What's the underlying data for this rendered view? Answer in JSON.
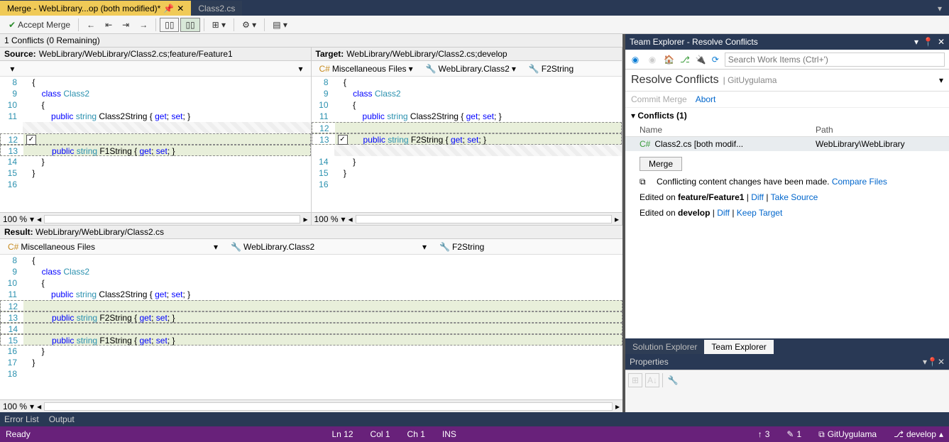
{
  "tabs": {
    "active": "Merge - WebLibrary...op (both modified)*",
    "other": "Class2.cs"
  },
  "toolbar": {
    "accept": "Accept Merge"
  },
  "conflicts_summary": "1 Conflicts (0 Remaining)",
  "source": {
    "label": "Source:",
    "path": "WebLibrary/WebLibrary/Class2.cs;feature/Feature1",
    "zoom": "100 %"
  },
  "target": {
    "label": "Target:",
    "path": "WebLibrary/WebLibrary/Class2.cs;develop",
    "crumb1": "Miscellaneous Files",
    "crumb2": "WebLibrary.Class2",
    "crumb3": "F2String",
    "zoom": "100 %"
  },
  "result": {
    "label": "Result:",
    "path": "WebLibrary/WebLibrary/Class2.cs",
    "crumb1": "Miscellaneous Files",
    "crumb2": "WebLibrary.Class2",
    "crumb3": "F2String",
    "zoom": "100 %"
  },
  "code": {
    "source_lines": [
      {
        "n": 8,
        "t": "    {"
      },
      {
        "n": 9,
        "t": "        class Class2"
      },
      {
        "n": 10,
        "t": "        {"
      },
      {
        "n": 11,
        "t": "            public string Class2String { get; set; }"
      },
      {
        "n": "",
        "t": "",
        "hatch": true
      },
      {
        "n": 12,
        "t": "",
        "diff": true,
        "cb": true
      },
      {
        "n": 13,
        "t": "            public string F1String { get; set; }",
        "diff": true
      },
      {
        "n": 14,
        "t": "        }"
      },
      {
        "n": 15,
        "t": "    }"
      },
      {
        "n": 16,
        "t": ""
      }
    ],
    "target_lines": [
      {
        "n": 8,
        "t": "    {"
      },
      {
        "n": 9,
        "t": "        class Class2"
      },
      {
        "n": 10,
        "t": "        {"
      },
      {
        "n": 11,
        "t": "            public string Class2String { get; set; }"
      },
      {
        "n": 12,
        "t": "",
        "diff": true
      },
      {
        "n": 13,
        "t": "            public string F2String { get; set; }",
        "diff": true,
        "cb": true
      },
      {
        "n": "",
        "t": "",
        "hatch": true
      },
      {
        "n": 14,
        "t": "        }"
      },
      {
        "n": 15,
        "t": "    }"
      },
      {
        "n": 16,
        "t": ""
      }
    ],
    "result_lines": [
      {
        "n": 8,
        "t": "    {"
      },
      {
        "n": 9,
        "t": "        class Class2"
      },
      {
        "n": 10,
        "t": "        {"
      },
      {
        "n": 11,
        "t": "            public string Class2String { get; set; }"
      },
      {
        "n": 12,
        "t": "",
        "diff": true
      },
      {
        "n": 13,
        "t": "            public string F2String { get; set; }",
        "diff": true
      },
      {
        "n": 14,
        "t": "",
        "diff": true
      },
      {
        "n": 15,
        "t": "            public string F1String { get; set; }",
        "diff": true
      },
      {
        "n": 16,
        "t": "        }"
      },
      {
        "n": 17,
        "t": "    }"
      },
      {
        "n": 18,
        "t": ""
      }
    ]
  },
  "team_explorer": {
    "title": "Team Explorer - Resolve Conflicts",
    "search_placeholder": "Search Work Items (Ctrl+')",
    "heading": "Resolve Conflicts",
    "project": "GitUygulama",
    "commit_merge": "Commit Merge",
    "abort": "Abort",
    "conflicts_label": "Conflicts (1)",
    "col_name": "Name",
    "col_path": "Path",
    "row_name": "Class2.cs [both modif...",
    "row_path": "WebLibrary\\WebLibrary",
    "merge_btn": "Merge",
    "info_text": "Conflicting content changes have been made.",
    "compare_files": "Compare Files",
    "edited1_a": "Edited on ",
    "edited1_b": "feature/Feature1",
    "diff": "Diff",
    "take_source": "Take Source",
    "edited2_a": "Edited on ",
    "edited2_b": "develop",
    "keep_target": "Keep Target"
  },
  "right_tabs": {
    "solution": "Solution Explorer",
    "team": "Team Explorer"
  },
  "properties": {
    "title": "Properties"
  },
  "bottom": {
    "errors": "Error List",
    "output": "Output"
  },
  "status": {
    "ready": "Ready",
    "ln": "Ln 12",
    "col": "Col 1",
    "ch": "Ch 1",
    "ins": "INS",
    "up": "3",
    "pencil": "1",
    "repo": "GitUygulama",
    "branch": "develop"
  }
}
